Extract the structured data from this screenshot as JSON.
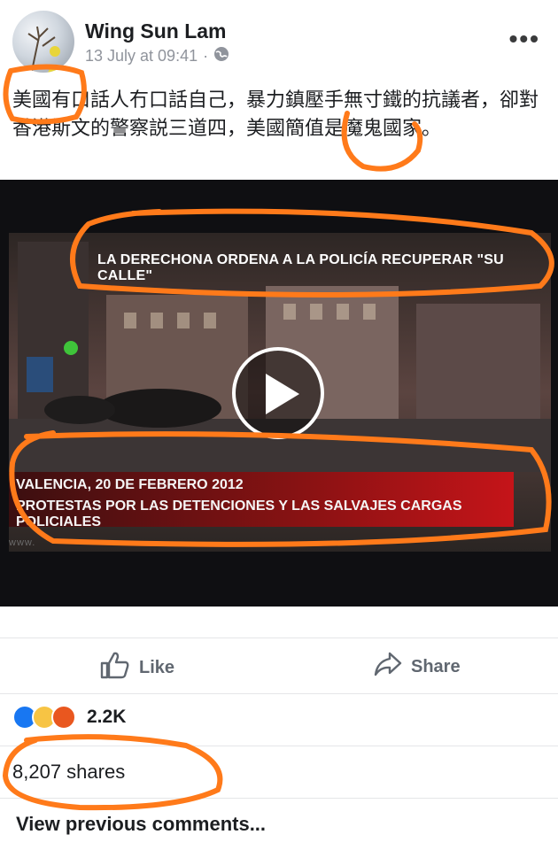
{
  "post": {
    "author": "Wing Sun Lam",
    "timestamp": "13 July at 09:41",
    "separator": "·",
    "privacy_icon": "globe-icon",
    "more_icon": "more-options-icon",
    "text": "美國有口話人冇口話自己，暴力鎮壓手無寸鐵的抗議者，卻對香港斯文的警察説三道四，美國簡值是魔鬼國家。"
  },
  "video": {
    "overlay_text": "LA DERECHONA ORDENA A LA POLICÍA RECUPERAR \"SU CALLE\"",
    "caption_line1": "VALENCIA, 20 DE FEBRERO 2012",
    "caption_line2": "PROTESTAS POR  LAS DETENCIONES Y LAS SALVAJES  CARGAS POLICIALES",
    "watermark": "www.",
    "play_icon": "play-icon"
  },
  "actions": {
    "like_label": "Like",
    "share_label": "Share"
  },
  "stats": {
    "reactions_count": "2.2K",
    "reaction_icons": [
      "like-reaction-icon",
      "haha-reaction-icon",
      "angry-reaction-icon"
    ],
    "shares_text": "8,207 shares"
  },
  "comments": {
    "view_previous": "View previous comments..."
  },
  "colors": {
    "highlight": "#ff7a1a",
    "caption_red": "#c51419",
    "fb_blue": "#1877f2",
    "muted": "#90949c"
  }
}
